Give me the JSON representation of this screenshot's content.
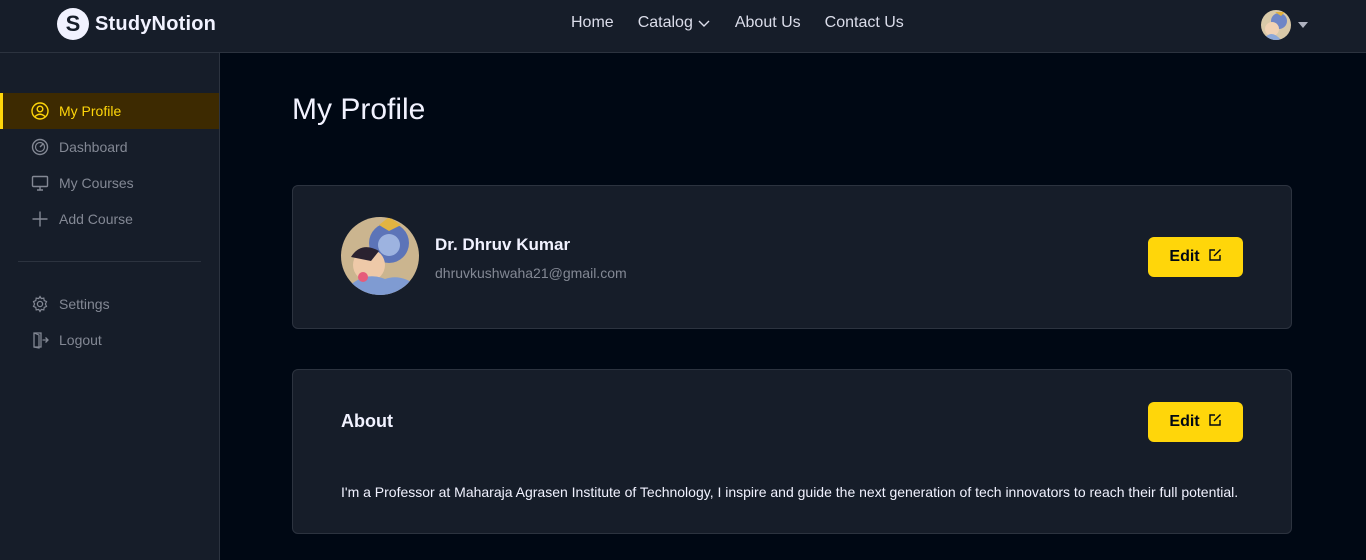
{
  "brand": {
    "name": "StudyNotion",
    "mark": "S"
  },
  "nav": {
    "home": "Home",
    "catalog": "Catalog",
    "about": "About Us",
    "contact": "Contact Us"
  },
  "sidebar": {
    "items": [
      {
        "label": "My Profile",
        "icon": "user-circle-icon",
        "active": true
      },
      {
        "label": "Dashboard",
        "icon": "gauge-icon"
      },
      {
        "label": "My Courses",
        "icon": "monitor-icon"
      },
      {
        "label": "Add Course",
        "icon": "plus-icon"
      }
    ],
    "bottom": [
      {
        "label": "Settings",
        "icon": "gear-icon"
      },
      {
        "label": "Logout",
        "icon": "logout-icon"
      }
    ]
  },
  "main": {
    "title": "My Profile",
    "profile": {
      "name": "Dr. Dhruv Kumar",
      "email": "dhruvkushwaha21@gmail.com",
      "edit_label": "Edit"
    },
    "about": {
      "title": "About",
      "edit_label": "Edit",
      "text": "I'm a Professor at Maharaja Agrasen Institute of Technology, I inspire and guide the next generation of tech innovators to reach their full potential."
    }
  },
  "colors": {
    "accent": "#FFD60A",
    "background": "#000814",
    "surface": "#161D29",
    "active_bg": "#3D2A01"
  }
}
